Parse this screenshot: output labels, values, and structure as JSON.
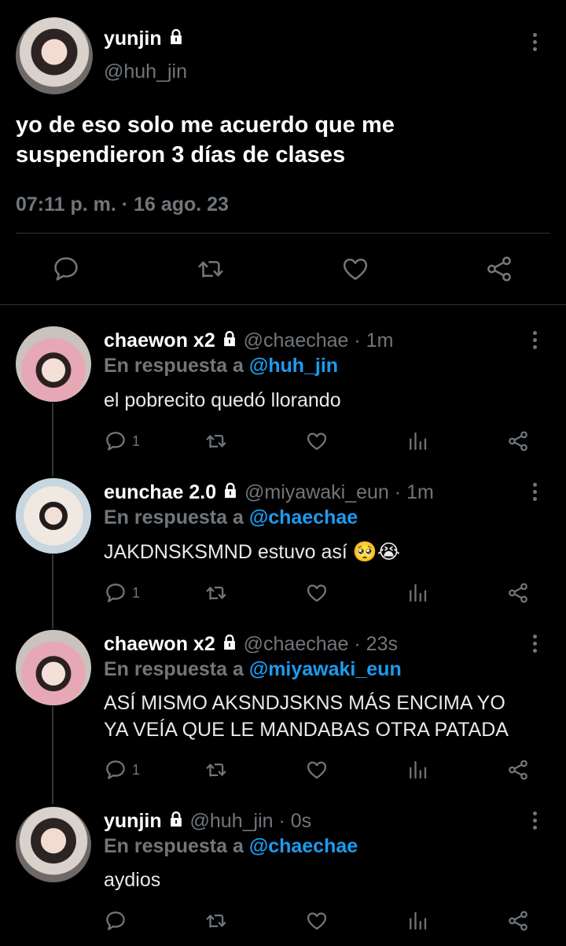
{
  "main_tweet": {
    "display_name": "yunjin",
    "handle": "@huh_jin",
    "text_line1": "yo de eso solo me acuerdo que me",
    "text_line2": "suspendieron 3 días de clases",
    "timestamp": "07:11 p. m. · 16 ago. 23"
  },
  "replies": [
    {
      "display_name": "chaewon x2",
      "handle": "@chaechae",
      "time": "· 1m",
      "reply_prefix": "En respuesta a",
      "reply_to": "@huh_jin",
      "text_line1": "el pobrecito quedó llorando",
      "text_line2": "",
      "reply_count": "1"
    },
    {
      "display_name": "eunchae 2.0",
      "handle": "@miyawaki_eun",
      "time": "· 1m",
      "reply_prefix": "En respuesta a",
      "reply_to": "@chaechae",
      "text_line1": "JAKDNSKSMND estuvo así 🥺😭",
      "text_line2": "",
      "reply_count": "1"
    },
    {
      "display_name": "chaewon x2",
      "handle": "@chaechae",
      "time": "· 23s",
      "reply_prefix": "En respuesta a",
      "reply_to": "@miyawaki_eun",
      "text_line1": "ASÍ MISMO AKSNDJSKNS MÁS ENCIMA YO",
      "text_line2": "YA VEÍA QUE LE MANDABAS OTRA PATADA",
      "reply_count": "1"
    },
    {
      "display_name": "yunjin",
      "handle": "@huh_jin",
      "time": "· 0s",
      "reply_prefix": "En respuesta a",
      "reply_to": "@chaechae",
      "text_line1": "aydios",
      "text_line2": "",
      "reply_count": ""
    }
  ],
  "icons": {
    "reply": "reply-icon",
    "retweet": "retweet-icon",
    "like": "heart-icon",
    "analytics": "analytics-icon",
    "share": "share-icon",
    "lock": "lock-icon",
    "more": "more-vertical-icon"
  },
  "colors": {
    "background": "#000000",
    "text": "#e7e9ea",
    "muted": "#71767b",
    "link": "#1d9bf0",
    "divider": "#2f3336"
  }
}
